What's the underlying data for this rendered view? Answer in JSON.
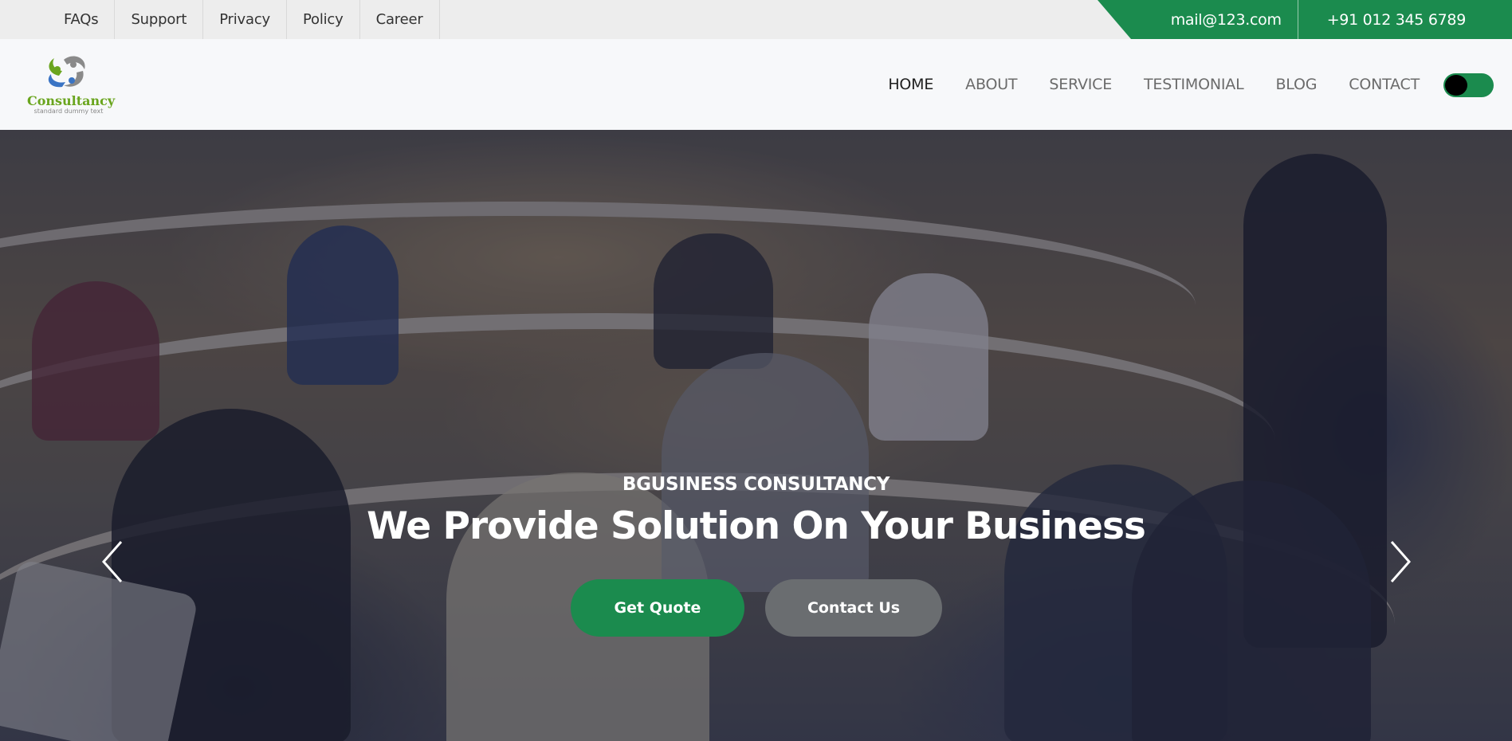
{
  "topbar": {
    "links": [
      "FAQs",
      "Support",
      "Privacy",
      "Policy",
      "Career"
    ],
    "email": "mail@123.com",
    "phone": "+91 012 345 6789"
  },
  "brand": {
    "name": "Consultancy",
    "tagline": "standard dummy text",
    "colors": {
      "primary": "#1b8b4e",
      "logo_green": "#6aa51e",
      "logo_blue": "#3a74c4"
    }
  },
  "nav": {
    "items": [
      "HOME",
      "ABOUT",
      "SERVICE",
      "TESTIMONIAL",
      "BLOG",
      "CONTACT"
    ],
    "active": "HOME",
    "theme_toggle": {
      "icon": "toggle-switch-icon"
    }
  },
  "hero": {
    "subtitle": "BGUSINESS CONSULTANCY",
    "title": "We Provide Solution On Your Business",
    "primary_button": "Get Quote",
    "secondary_button": "Contact Us",
    "prev_icon": "chevron-left-icon",
    "next_icon": "chevron-right-icon"
  }
}
